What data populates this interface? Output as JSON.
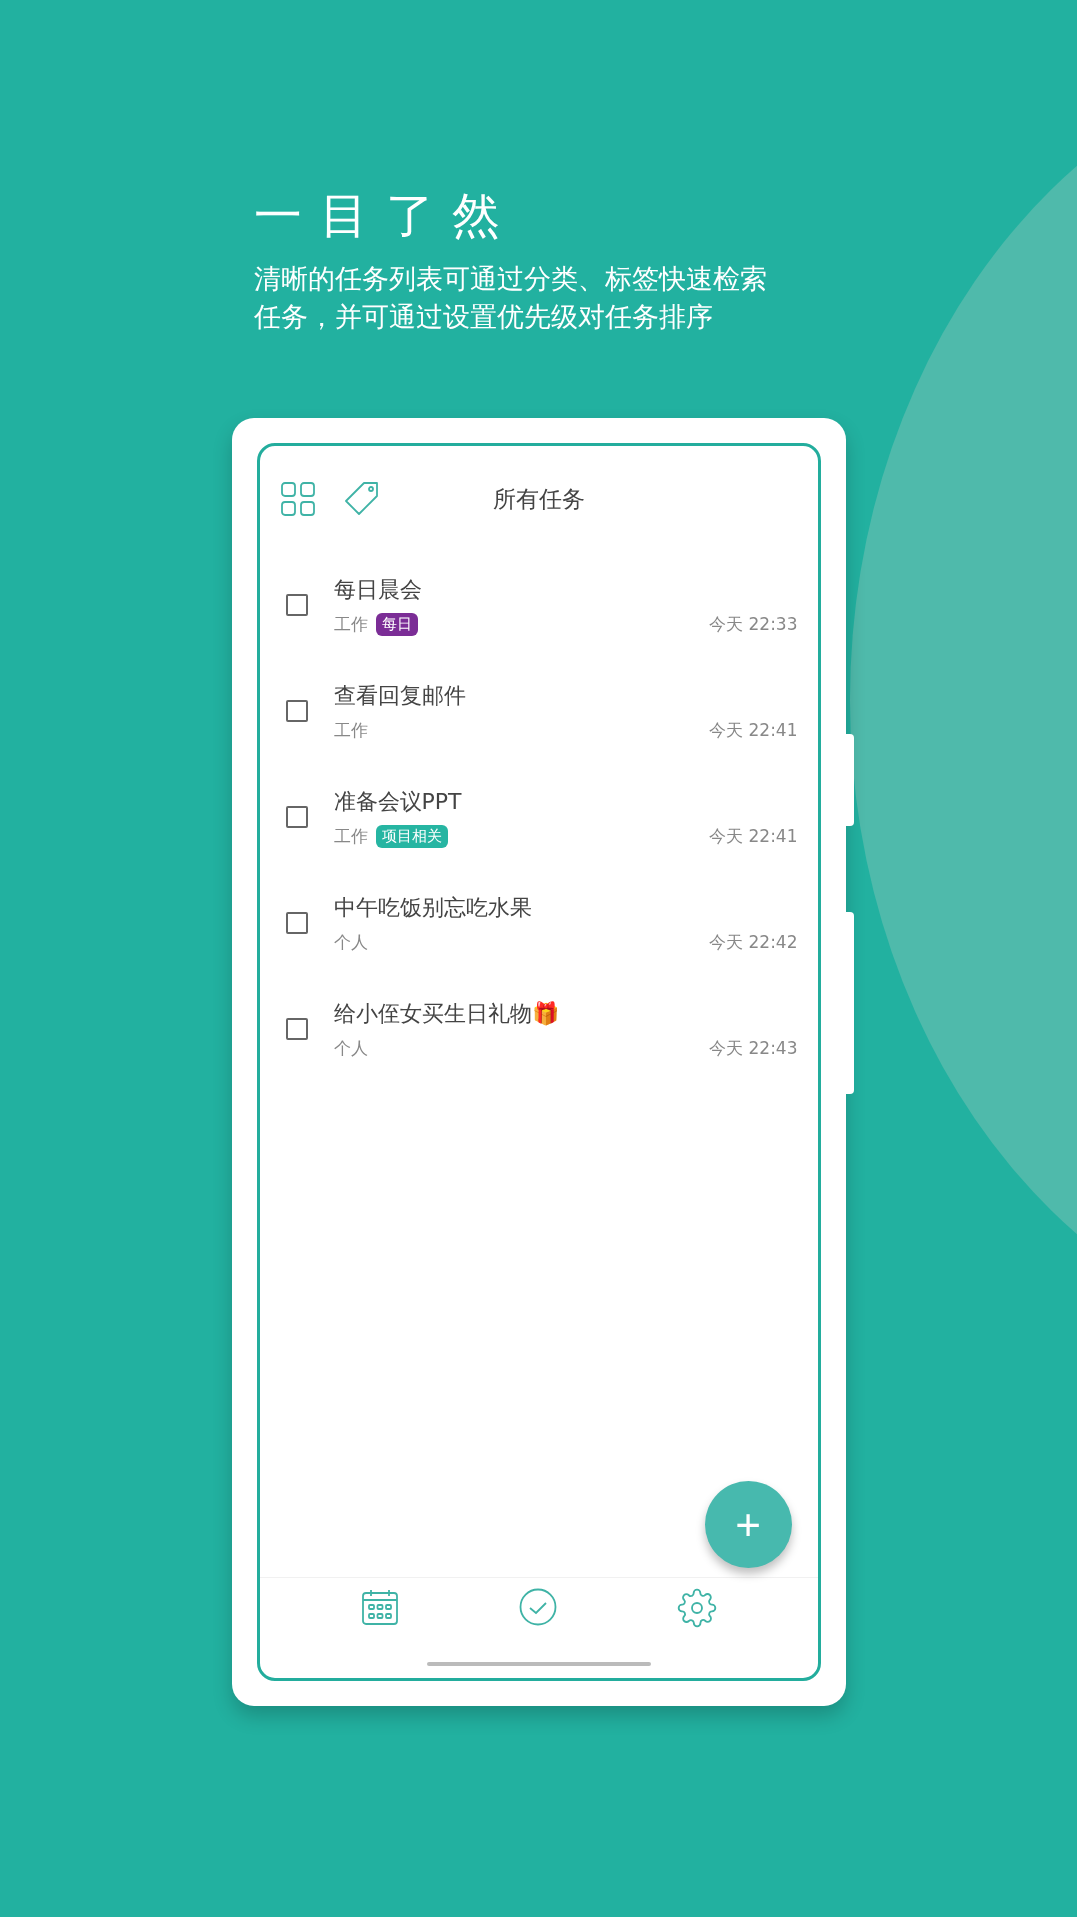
{
  "headline": "一目了然",
  "subtitle": [
    "清晰的任务列表可通过分类、标签快速检索",
    "任务，并可通过设置优先级对任务排序"
  ],
  "app": {
    "title": "所有任务",
    "tasks": [
      {
        "title": "每日晨会",
        "category": "工作",
        "tag": {
          "label": "每日",
          "color": "#7b2d96"
        },
        "time": "今天 22:33",
        "checked": false
      },
      {
        "title": "查看回复邮件",
        "category": "工作",
        "time": "今天 22:41",
        "checked": false
      },
      {
        "title": "准备会议PPT",
        "category": "工作",
        "tag": {
          "label": "项目相关",
          "color": "#26b5a2"
        },
        "time": "今天 22:41",
        "checked": false
      },
      {
        "title": "中午吃饭别忘吃水果",
        "category": "个人",
        "time": "今天 22:42",
        "checked": false
      },
      {
        "title": "给小侄女买生日礼物🎁",
        "category": "个人",
        "time": "今天 22:43",
        "checked": false
      }
    ],
    "fab": "+"
  }
}
